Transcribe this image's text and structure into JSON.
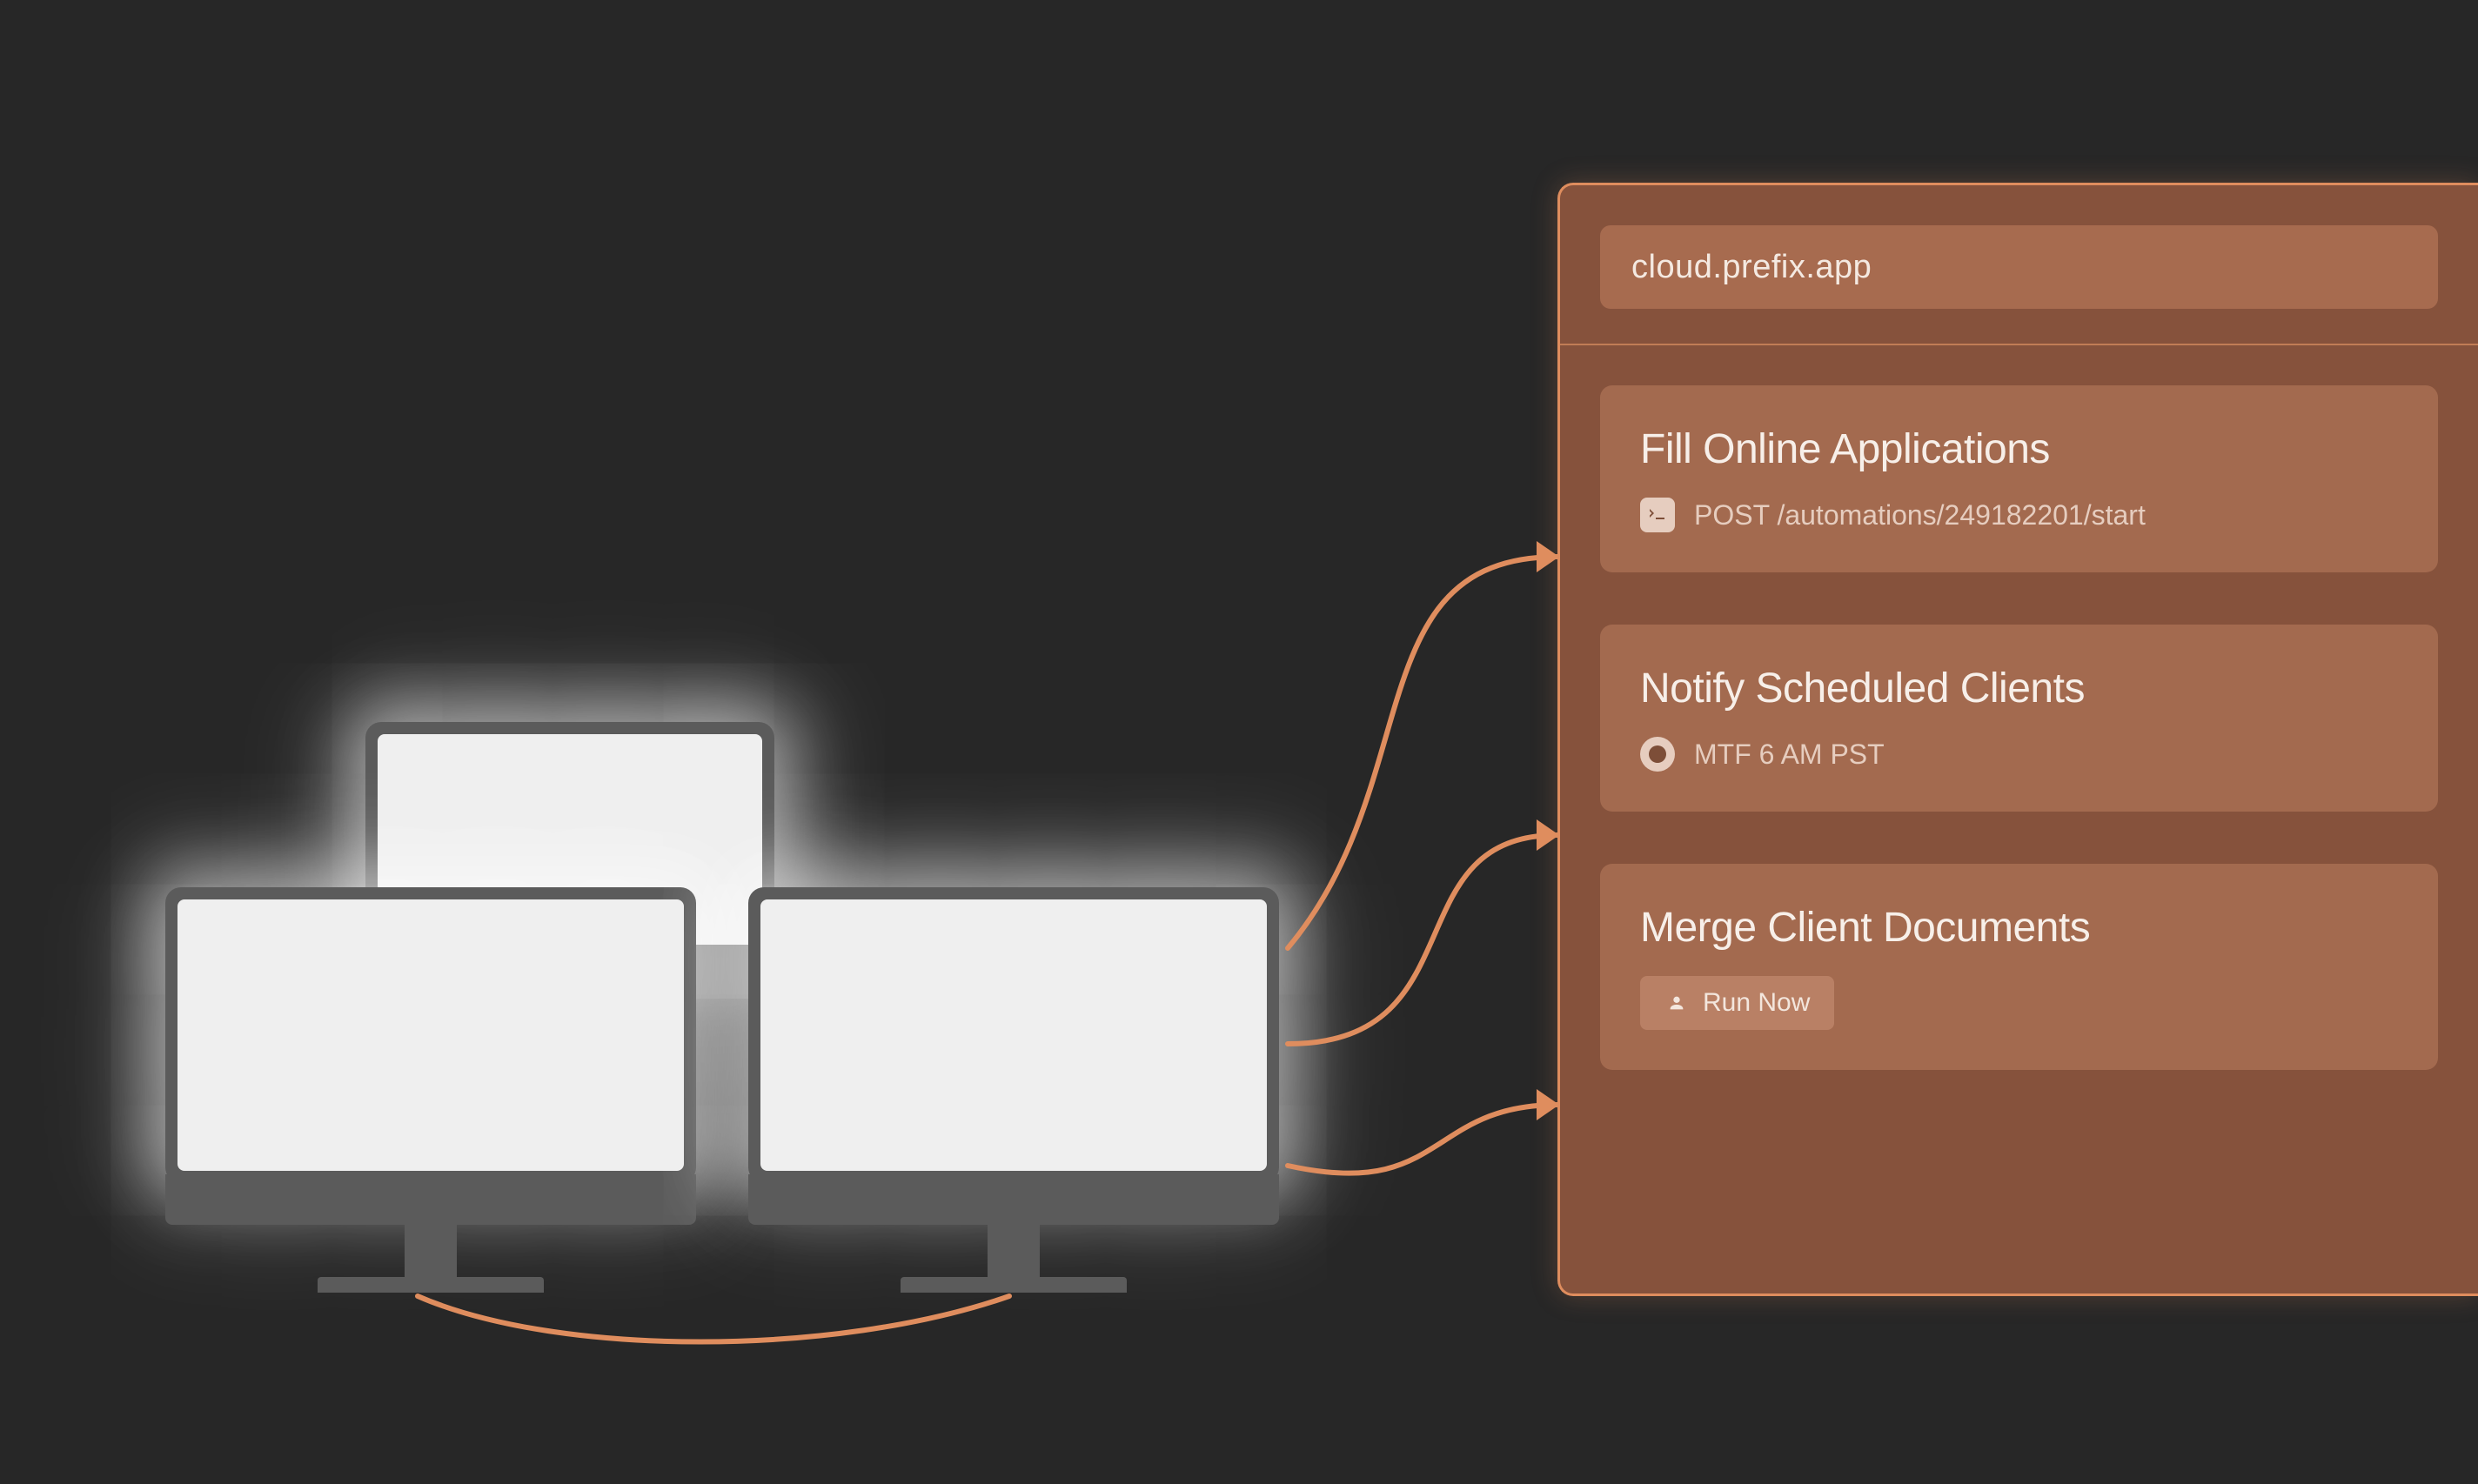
{
  "cloud": {
    "url": "cloud.prefix.app",
    "cards": [
      {
        "title": "Fill Online Applications",
        "meta_kind": "api",
        "meta_text": "POST /automations/249182201/start"
      },
      {
        "title": "Notify Scheduled Clients",
        "meta_kind": "schedule",
        "meta_text": "MTF 6 AM PST"
      },
      {
        "title": "Merge Client Documents",
        "meta_kind": "run",
        "meta_text": "Run Now"
      }
    ]
  },
  "colors": {
    "accent": "#df8d5e",
    "panel": "#86523c",
    "card": "#a36a4f",
    "bg": "#272727"
  }
}
